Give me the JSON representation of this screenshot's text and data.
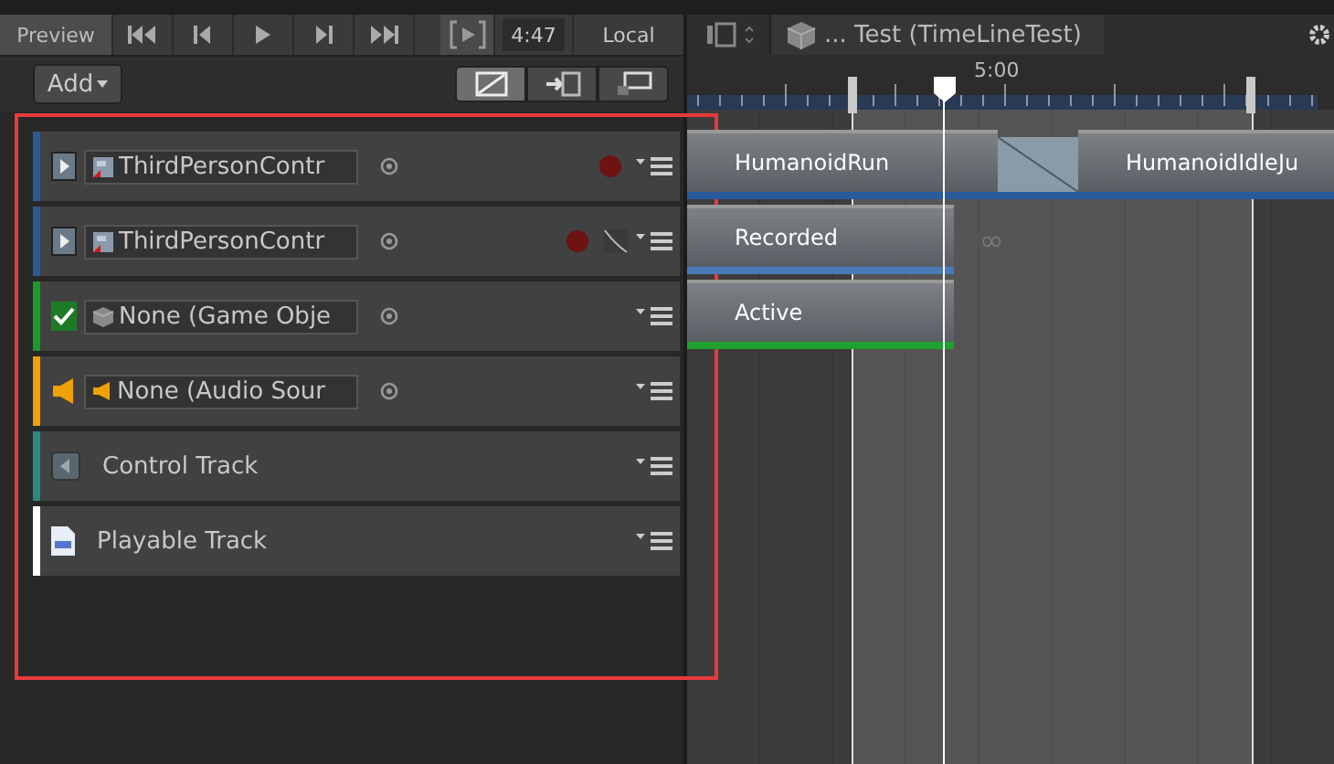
{
  "toolbar": {
    "preview": {
      "label": "Preview",
      "selected": true
    },
    "time": "4:47",
    "space": "Local"
  },
  "add_button": "Add",
  "mode_buttons": [
    {
      "selected": true
    },
    {
      "selected": false
    },
    {
      "selected": false
    }
  ],
  "breadcrumb": "... Test (TimeLineTest)",
  "ruler": {
    "label": "5:00"
  },
  "tracks": [
    {
      "kind": "animation",
      "color": "#2c5a94",
      "binding": "ThirdPersonContr",
      "record": true,
      "curves": false,
      "clips": [
        {
          "kind": "clip",
          "label": "HumanoidRun",
          "color": "#2a5a9c"
        },
        {
          "kind": "blend"
        },
        {
          "kind": "clip",
          "label": "HumanoidIdleJu",
          "color": "#2a5a9c"
        }
      ]
    },
    {
      "kind": "animation",
      "color": "#2c5a94",
      "binding": "ThirdPersonContr",
      "record": true,
      "curves": true,
      "clips": [
        {
          "kind": "clip",
          "label": "Recorded",
          "color": "#4a7ab8"
        }
      ],
      "extrapolation": "∞"
    },
    {
      "kind": "activation",
      "color": "#1a9a2a",
      "binding": "None (Game Obje",
      "checked": true,
      "clips": [
        {
          "kind": "clip",
          "label": "Active",
          "color": "#1fa02f"
        }
      ]
    },
    {
      "kind": "audio",
      "color": "#f0a000",
      "binding": "None (Audio Sour"
    },
    {
      "kind": "control",
      "color": "#2a8a80",
      "label": "Control Track"
    },
    {
      "kind": "playable",
      "color": "#ffffff",
      "label": "Playable Track"
    }
  ]
}
